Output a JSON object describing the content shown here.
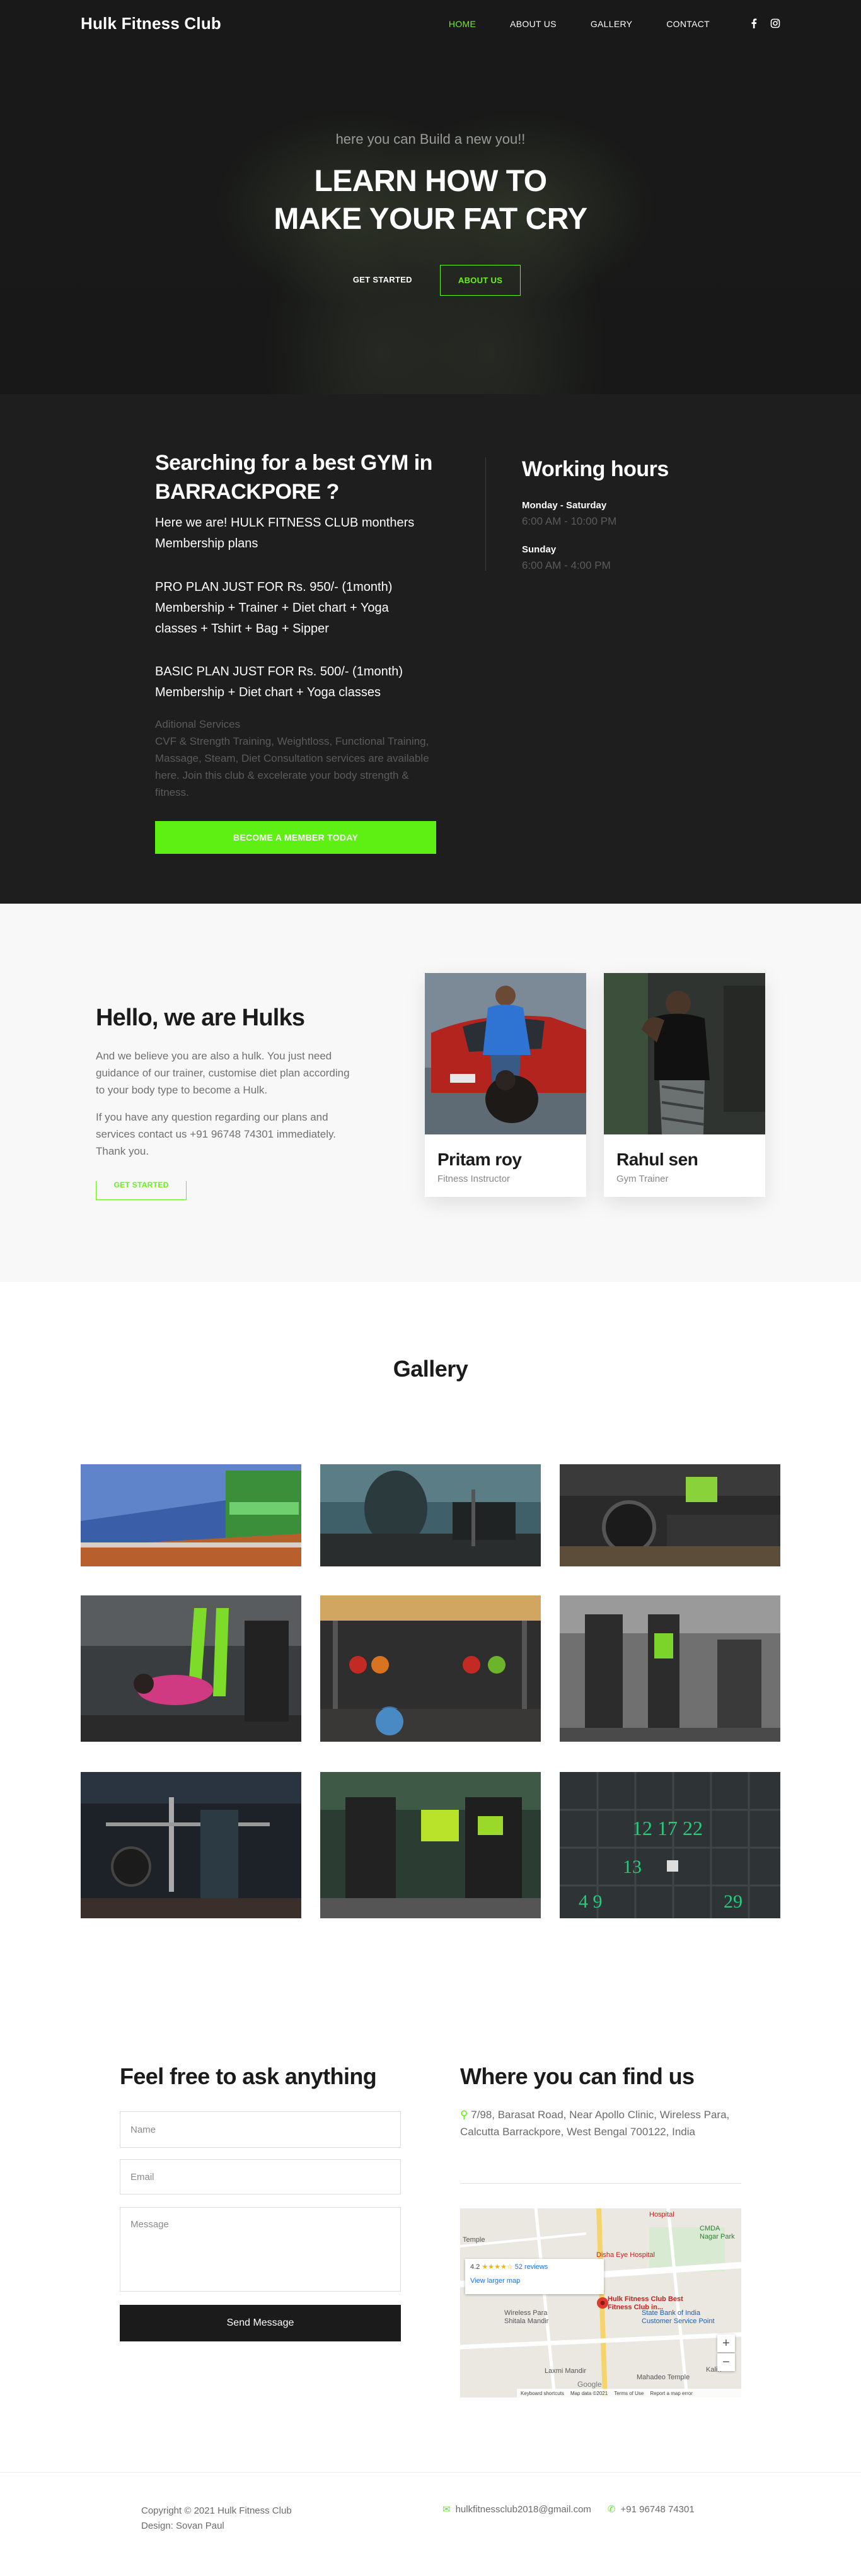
{
  "nav": {
    "brand": "Hulk Fitness Club",
    "items": [
      "HOME",
      "ABOUT US",
      "GALLERY",
      "CONTACT"
    ],
    "social": [
      "facebook-icon",
      "instagram-icon"
    ],
    "accent": "#6bf01a"
  },
  "hero": {
    "subtitle": "here you can Build a new you!!",
    "title_line1": "LEARN HOW TO",
    "title_line2": "MAKE YOUR FAT CRY",
    "primary_button": "GET STARTED",
    "secondary_button": "ABOUT US"
  },
  "info": {
    "heading": "Searching for a best GYM in BARRACKPORE ?",
    "intro": "Here we are! HULK FITNESS CLUB monthers Membership plans",
    "pro_plan": "PRO PLAN JUST FOR Rs. 950/- (1month) Membership + Trainer + Diet chart + Yoga classes + Tshirt + Bag + Sipper",
    "basic_plan": "BASIC PLAN JUST FOR Rs. 500/- (1month) Membership + Diet chart + Yoga classes",
    "additional_title": "Aditional Services",
    "additional_text": "CVF & Strength Training, Weightloss, Functional Training, Massage, Steam, Diet Consultation services are available here. Join this club & excelerate your body strength & fitness.",
    "cta": "BECOME A MEMBER TODAY",
    "cta_color": "#5ef012",
    "working_hours": {
      "title": "Working hours",
      "days": [
        {
          "day": "Monday - Saturday",
          "time": "6:00 AM - 10:00 PM"
        },
        {
          "day": "Sunday",
          "time": "6:00 AM - 4:00 PM"
        }
      ]
    }
  },
  "about": {
    "heading": "Hello, we are Hulks",
    "para1": "And we believe you are also a hulk. You just need guidance of our trainer, customise diet plan according to your body type to become a Hulk.",
    "para2": "If you have any question regarding our plans and services contact us +91 96748 74301 immediately. Thank you.",
    "button": "GET STARTED",
    "trainers": [
      {
        "name": "Pritam roy",
        "role": "Fitness Instructor"
      },
      {
        "name": "Rahul sen",
        "role": "Gym Trainer"
      }
    ]
  },
  "gallery": {
    "title": "Gallery"
  },
  "contact": {
    "title": "Feel free to ask anything",
    "name_placeholder": "Name",
    "email_placeholder": "Email",
    "message_placeholder": "Message",
    "send": "Send Message"
  },
  "location": {
    "title": "Where you can find us",
    "address": "7/98, Barasat Road, Near Apollo Clinic, Wireless Para, Calcutta Barrackpore, West Bengal 700122, India",
    "map": {
      "rating": "4.2",
      "reviews_label": "52 reviews",
      "view_larger": "View larger map",
      "place_label": "Hulk Fitness Club Best Fitness Club in...",
      "labels": [
        "Disha Eye Hospital",
        "CMDA Nagar Park",
        "Wireless Para Shitala Mandir",
        "State Bank of India Customer Service Point",
        "Laxmi Mandir",
        "Mahadeo Temple",
        "Hospital",
        "Temple",
        "Kalin"
      ],
      "footer": [
        "Keyboard shortcuts",
        "Map data ©2021",
        "Terms of Use",
        "Report a map error"
      ]
    }
  },
  "footer": {
    "copyright": "Copyright © 2021 Hulk Fitness Club",
    "design": "Design: Sovan Paul",
    "email": "hulkfitnessclub2018@gmail.com",
    "phone": "+91 96748 74301"
  }
}
